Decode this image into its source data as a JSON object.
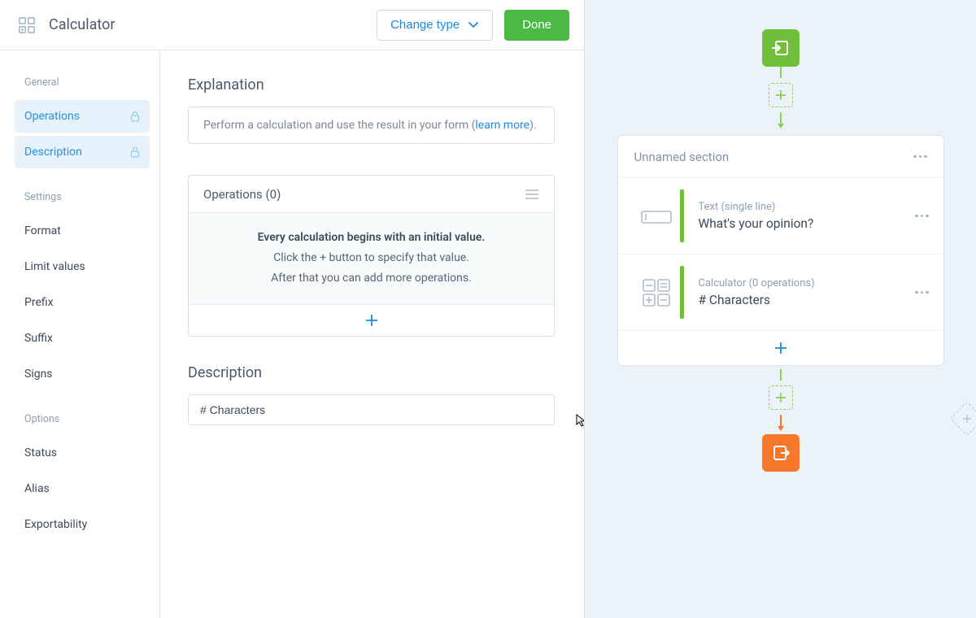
{
  "header": {
    "title": "Calculator",
    "change_type_label": "Change type",
    "done_label": "Done"
  },
  "sidebar": {
    "groups": [
      {
        "label": "General",
        "items": [
          {
            "label": "Operations",
            "locked": true,
            "active": true
          },
          {
            "label": "Description",
            "locked": true,
            "active": true
          }
        ]
      },
      {
        "label": "Settings",
        "items": [
          {
            "label": "Format"
          },
          {
            "label": "Limit values"
          },
          {
            "label": "Prefix"
          },
          {
            "label": "Suffix"
          },
          {
            "label": "Signs"
          }
        ]
      },
      {
        "label": "Options",
        "items": [
          {
            "label": "Status"
          },
          {
            "label": "Alias"
          },
          {
            "label": "Exportability"
          }
        ]
      }
    ]
  },
  "explanation": {
    "title": "Explanation",
    "text": "Perform a calculation and use the result in your form (",
    "link": "learn more",
    "tail": ")."
  },
  "operations": {
    "title": "Operations (0)",
    "empty_line1": "Every calculation begins with an initial value.",
    "empty_line2": "Click the + button to specify that value.",
    "empty_line3": "After that you can add more operations."
  },
  "description": {
    "title": "Description",
    "value": "# Characters"
  },
  "preview": {
    "section_name": "Unnamed section",
    "fields": [
      {
        "type": "Text (single line)",
        "label": "What's your opinion?",
        "icon": "text-input"
      },
      {
        "type": "Calculator (0 operations)",
        "label": "# Characters",
        "icon": "calculator"
      }
    ]
  }
}
